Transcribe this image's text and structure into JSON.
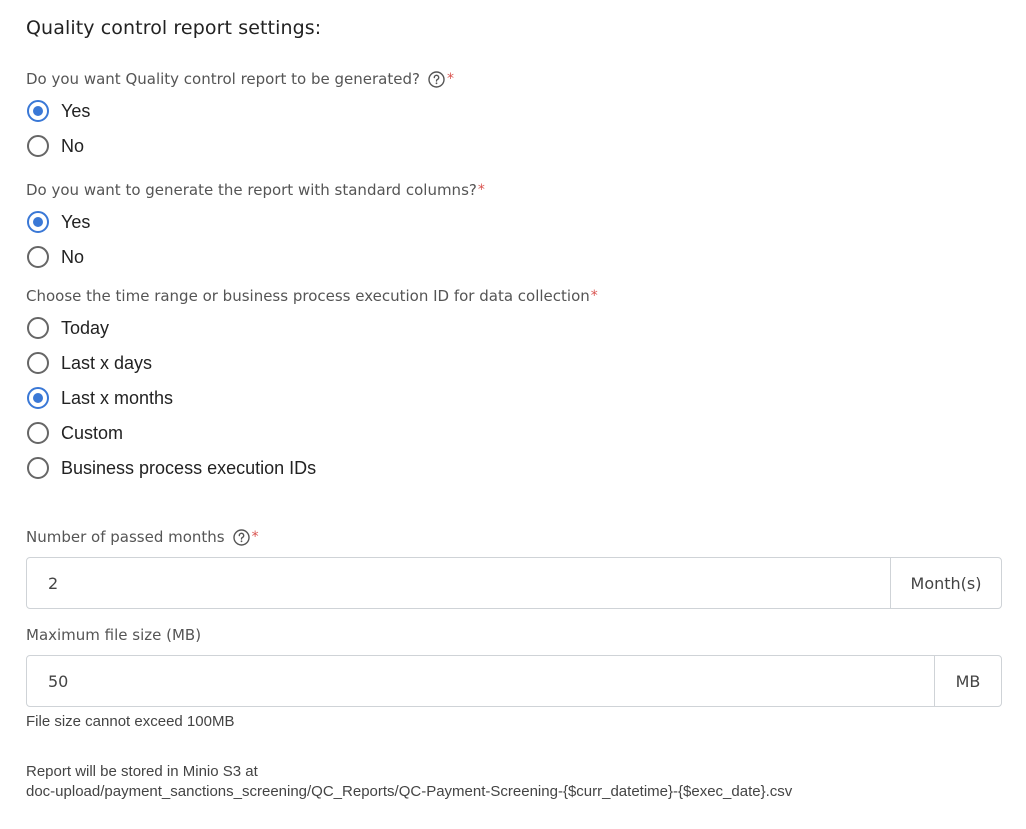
{
  "section": {
    "title": "Quality control report settings:"
  },
  "q1": {
    "label": "Do you want Quality control report to be generated?",
    "required_mark": "*",
    "help_icon": "question-circle-icon",
    "options": [
      {
        "label": "Yes",
        "checked": true
      },
      {
        "label": "No",
        "checked": false
      }
    ]
  },
  "q2": {
    "label": "Do you want to generate the report with standard columns?",
    "required_mark": "*",
    "options": [
      {
        "label": "Yes",
        "checked": true
      },
      {
        "label": "No",
        "checked": false
      }
    ]
  },
  "q3": {
    "label": "Choose the time range or business process execution ID for data collection",
    "required_mark": "*",
    "options": [
      {
        "label": "Today",
        "checked": false
      },
      {
        "label": "Last x days",
        "checked": false
      },
      {
        "label": "Last x months",
        "checked": true
      },
      {
        "label": "Custom",
        "checked": false
      },
      {
        "label": "Business process execution IDs",
        "checked": false
      }
    ]
  },
  "months": {
    "label": "Number of passed months",
    "required_mark": "*",
    "help_icon": "question-circle-icon",
    "value": "2",
    "suffix": "Month(s)"
  },
  "filesize": {
    "label": "Maximum file size (MB)",
    "value": "50",
    "suffix": "MB",
    "help_text": "File size cannot exceed 100MB"
  },
  "storage_note": {
    "line1": "Report will be stored in Minio S3 at",
    "line2": "doc-upload/payment_sanctions_screening/QC_Reports/QC-Payment-Screening-{$curr_datetime}-{$exec_date}.csv"
  },
  "colors": {
    "accent": "#3a78d6",
    "required": "#d9534f"
  }
}
